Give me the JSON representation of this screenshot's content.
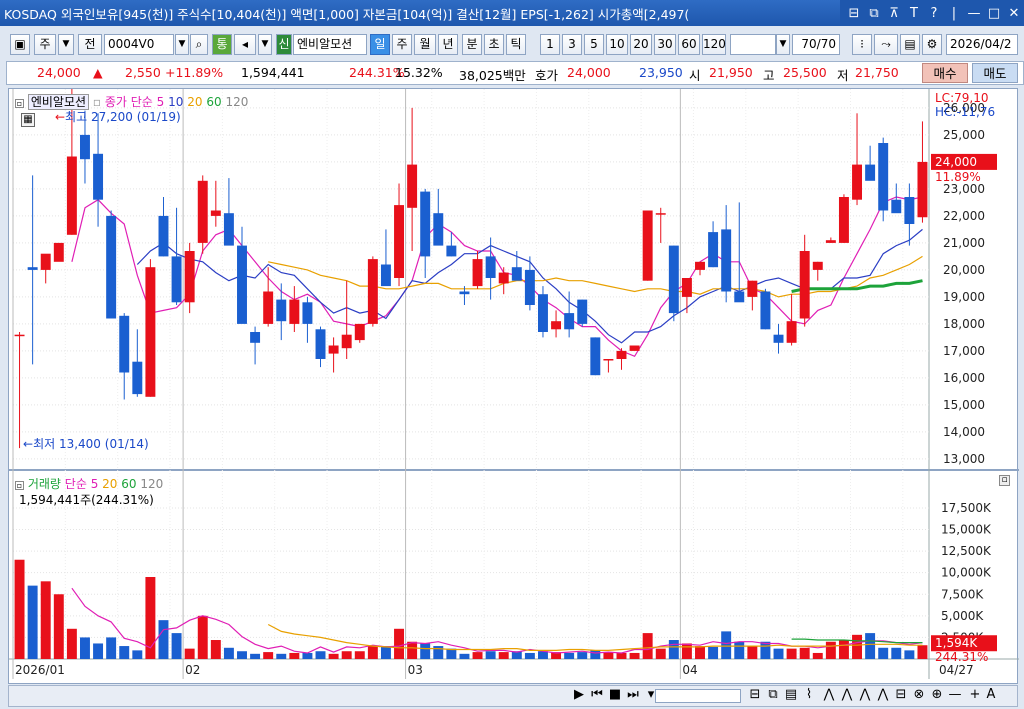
{
  "window": {
    "title": "KOSDAQ 외국인보유[945(천)] 주식수[10,404(천)] 액면[1,000] 자본금[104(억)] 결산[12월] EPS[-1,262] 시가총액[2,497(",
    "controls": [
      "⊟",
      "⧉",
      "⊼",
      "T",
      "?",
      "|",
      "—",
      "□",
      "✕"
    ]
  },
  "toolbar": {
    "code_type": "주",
    "period_label": "전",
    "code": "0004V0",
    "tong": "통",
    "sin": "신",
    "stock_name": "엔비알모션",
    "periods": [
      "일",
      "주",
      "월",
      "년",
      "분",
      "초",
      "틱"
    ],
    "selected_period": "일",
    "intervals": [
      "1",
      "3",
      "5",
      "10",
      "20",
      "30",
      "60",
      "120"
    ],
    "count": "70/70",
    "date": "2026/04/2"
  },
  "quote": {
    "price": "24,000",
    "arrow": "▲",
    "change": "2,550",
    "change_pct": "+11.89%",
    "volume": "1,594,441",
    "vol_ratio": "244.31%",
    "turnover": "15.32%",
    "amount": "38,025백만",
    "hoga_label": "호가",
    "hoga_ask": "24,000",
    "hoga_bid": "23,950",
    "open_label": "시",
    "open": "21,950",
    "high_label": "고",
    "high": "25,500",
    "low_label": "저",
    "low": "21,750",
    "buy_label": "매수",
    "sell_label": "매도"
  },
  "chart_data": {
    "type": "candlestick",
    "price_legend": {
      "name": "엔비알모션",
      "ma_label": "종가 단순",
      "ma_periods": [
        "5",
        "10",
        "20",
        "60",
        "120"
      ]
    },
    "volume_legend": {
      "name": "거래량",
      "ma_label": "단순",
      "ma_periods": [
        "5",
        "20",
        "60",
        "120"
      ],
      "value": "1,594,441주(244.31%)"
    },
    "annotations": {
      "high": "최고 27,200 (01/19)",
      "low": "최저 13,400 (01/14)"
    },
    "lc_hc": {
      "lc": "LC:79,10",
      "hc": "HC:-11,76"
    },
    "y_ticks": [
      "26,000",
      "25,000",
      "24,000",
      "23,000",
      "22,000",
      "21,000",
      "20,000",
      "19,000",
      "18,000",
      "17,000",
      "16,000",
      "15,000",
      "14,000",
      "13,000"
    ],
    "ylim": [
      12700,
      26700
    ],
    "current_price": {
      "value": 24000,
      "label": "24,000",
      "pct": "11.89%"
    },
    "vol_ticks": [
      "17,500K",
      "15,000K",
      "12,500K",
      "10,000K",
      "7,500K",
      "5,000K",
      "2,500K"
    ],
    "vol_ylim": [
      0,
      19000
    ],
    "current_volume": {
      "label": "1,594K",
      "pct": "244.31%"
    },
    "x_labels": [
      {
        "i": 0,
        "label": "2026/01"
      },
      {
        "i": 13,
        "label": "02"
      },
      {
        "i": 30,
        "label": "03"
      },
      {
        "i": 51,
        "label": "04"
      }
    ],
    "x_end_label": "04/27",
    "candles": [
      [
        17600,
        17700,
        13400,
        17600,
        11500
      ],
      [
        20100,
        23500,
        16500,
        20000,
        8500
      ],
      [
        20000,
        20200,
        19500,
        20600,
        9000
      ],
      [
        20300,
        20300,
        20300,
        21000,
        7500
      ],
      [
        21300,
        27200,
        21300,
        24200,
        3500
      ],
      [
        25000,
        25900,
        23200,
        24100,
        2500
      ],
      [
        24300,
        25800,
        21600,
        22600,
        1800
      ],
      [
        22000,
        22200,
        18300,
        18200,
        2500
      ],
      [
        18300,
        18400,
        15200,
        16200,
        1500
      ],
      [
        16600,
        17800,
        15300,
        15400,
        1000
      ],
      [
        15300,
        20400,
        15300,
        20100,
        9500
      ],
      [
        22000,
        22700,
        20500,
        20500,
        4500
      ],
      [
        20500,
        22300,
        18700,
        18800,
        3000
      ],
      [
        18800,
        21000,
        18400,
        20700,
        1200
      ],
      [
        21000,
        23500,
        20600,
        23300,
        5000
      ],
      [
        22000,
        23300,
        21600,
        22200,
        2200
      ],
      [
        22100,
        23400,
        21300,
        20900,
        1300
      ],
      [
        20900,
        21600,
        18200,
        18000,
        900
      ],
      [
        17700,
        17900,
        16500,
        17300,
        600
      ],
      [
        18000,
        20100,
        17900,
        19200,
        800
      ],
      [
        18900,
        19500,
        17400,
        18100,
        600
      ],
      [
        18000,
        19400,
        17700,
        18900,
        700
      ],
      [
        18800,
        19000,
        17300,
        18000,
        700
      ],
      [
        17800,
        17900,
        16400,
        16700,
        900
      ],
      [
        16900,
        17500,
        16200,
        17200,
        600
      ],
      [
        17100,
        19600,
        16700,
        17600,
        900
      ],
      [
        17400,
        18000,
        17300,
        18000,
        900
      ],
      [
        18000,
        20500,
        17900,
        20400,
        1500
      ],
      [
        20200,
        21500,
        19800,
        19400,
        1500
      ],
      [
        19700,
        23200,
        19400,
        22400,
        3500
      ],
      [
        22300,
        26000,
        20700,
        23900,
        2000
      ],
      [
        22900,
        23000,
        19700,
        20500,
        1800
      ],
      [
        22100,
        23000,
        21000,
        20900,
        1500
      ],
      [
        20900,
        21400,
        20500,
        20500,
        1200
      ],
      [
        19200,
        19400,
        18700,
        19100,
        600
      ],
      [
        19400,
        20700,
        19300,
        20400,
        800
      ],
      [
        20500,
        21200,
        18900,
        19700,
        900
      ],
      [
        19500,
        20100,
        19100,
        19900,
        800
      ],
      [
        20100,
        20700,
        19800,
        19600,
        900
      ],
      [
        20000,
        20500,
        18500,
        18700,
        700
      ],
      [
        19100,
        19400,
        17500,
        17700,
        900
      ],
      [
        17800,
        18500,
        17500,
        18100,
        800
      ],
      [
        18400,
        19200,
        17500,
        17800,
        700
      ],
      [
        18900,
        18900,
        17900,
        18000,
        800
      ],
      [
        17500,
        17500,
        16100,
        16100,
        1000
      ],
      [
        16700,
        16700,
        16200,
        16700,
        800
      ],
      [
        16700,
        17100,
        16300,
        17000,
        700
      ],
      [
        17000,
        17200,
        17200,
        17200,
        700
      ],
      [
        19600,
        22100,
        19600,
        22200,
        3000
      ],
      [
        22100,
        22300,
        21000,
        22100,
        1200
      ],
      [
        20900,
        20900,
        18100,
        18400,
        2200
      ],
      [
        19000,
        19600,
        18400,
        19700,
        1800
      ],
      [
        20000,
        20200,
        19800,
        20300,
        1500
      ],
      [
        21400,
        21800,
        20100,
        20100,
        1400
      ],
      [
        21500,
        22400,
        18800,
        19200,
        3200
      ],
      [
        19200,
        22500,
        19000,
        18800,
        2000
      ],
      [
        19000,
        19600,
        18500,
        19600,
        1500
      ],
      [
        19200,
        19300,
        17800,
        17800,
        2000
      ],
      [
        17600,
        18000,
        16900,
        17300,
        1200
      ],
      [
        17300,
        19100,
        17200,
        18100,
        1200
      ],
      [
        18200,
        21300,
        17900,
        20700,
        1300
      ],
      [
        20000,
        20300,
        19600,
        20300,
        700
      ],
      [
        21000,
        21200,
        21000,
        21100,
        2000
      ],
      [
        21000,
        22800,
        21000,
        22700,
        2200
      ],
      [
        22600,
        25800,
        22400,
        23900,
        2800
      ],
      [
        23900,
        24600,
        23500,
        23300,
        3000
      ],
      [
        24700,
        24900,
        21800,
        22200,
        1300
      ],
      [
        22600,
        23200,
        22300,
        22100,
        1300
      ],
      [
        22700,
        23200,
        20900,
        21700,
        1000
      ],
      [
        21950,
        25500,
        21750,
        24000,
        1594
      ]
    ],
    "ma_price": [
      {
        "period": "5",
        "color": "#e01fb5",
        "values": [
          null,
          null,
          null,
          null,
          20300,
          22300,
          22600,
          22100,
          21700,
          19800,
          18400,
          18500,
          18600,
          19100,
          20700,
          21300,
          21500,
          20900,
          20300,
          19700,
          19200,
          18900,
          19100,
          18800,
          18100,
          18000,
          17900,
          18100,
          18300,
          18900,
          19600,
          21200,
          21700,
          21400,
          20900,
          20700,
          20700,
          19900,
          19800,
          19400,
          18900,
          18600,
          18200,
          17900,
          17900,
          17400,
          17000,
          16800,
          17600,
          18600,
          19200,
          19500,
          20300,
          20600,
          20300,
          20300,
          19300,
          19100,
          18600,
          18100,
          18000,
          18500,
          18700,
          19700,
          20600,
          21500,
          22500,
          22700,
          22600,
          22700
        ]
      },
      {
        "period": "10",
        "color": "#2b3ec4",
        "values": [
          null,
          null,
          null,
          null,
          null,
          null,
          null,
          null,
          null,
          20200,
          20700,
          21000,
          20600,
          20400,
          20300,
          19900,
          19600,
          19800,
          19700,
          20200,
          19900,
          19800,
          19300,
          18800,
          18400,
          18600,
          18400,
          18500,
          18200,
          18900,
          19600,
          19500,
          19900,
          20200,
          20600,
          20600,
          20900,
          20700,
          20500,
          20300,
          19700,
          19300,
          18800,
          18500,
          18100,
          17600,
          17300,
          17700,
          17700,
          17900,
          18300,
          18600,
          19000,
          19200,
          19400,
          19200,
          19400,
          19600,
          19700,
          19500,
          19300,
          19300,
          19300,
          19700,
          19700,
          19800,
          20600,
          20900,
          21100,
          21500
        ]
      },
      {
        "period": "20",
        "color": "#e8a000",
        "values": [
          null,
          null,
          null,
          null,
          null,
          null,
          null,
          null,
          null,
          null,
          null,
          null,
          null,
          null,
          null,
          null,
          null,
          null,
          null,
          20300,
          20200,
          20100,
          20000,
          19800,
          19700,
          19600,
          19400,
          19400,
          19300,
          19300,
          19400,
          19500,
          19500,
          19300,
          19300,
          19300,
          19300,
          19500,
          19600,
          19600,
          19600,
          19700,
          19600,
          19600,
          19500,
          19400,
          19300,
          19200,
          19300,
          19300,
          19200,
          19200,
          19100,
          19300,
          19300,
          19300,
          19300,
          19200,
          19000,
          19100,
          19100,
          19200,
          19200,
          19300,
          19400,
          19700,
          19800,
          20000,
          20200,
          20500
        ]
      },
      {
        "period": "60",
        "color": "#1da33a",
        "values": [
          null,
          null,
          null,
          null,
          null,
          null,
          null,
          null,
          null,
          null,
          null,
          null,
          null,
          null,
          null,
          null,
          null,
          null,
          null,
          null,
          null,
          null,
          null,
          null,
          null,
          null,
          null,
          null,
          null,
          null,
          null,
          null,
          null,
          null,
          null,
          null,
          null,
          null,
          null,
          null,
          null,
          null,
          null,
          null,
          null,
          null,
          null,
          null,
          null,
          null,
          null,
          null,
          null,
          null,
          null,
          null,
          null,
          null,
          null,
          19200,
          19300,
          19300,
          19300,
          19300,
          19300,
          19400,
          19400,
          19500,
          19500,
          19600
        ]
      }
    ],
    "ma_volume": [
      {
        "period": "5",
        "color": "#e01fb5",
        "values": [
          null,
          null,
          null,
          null,
          8200,
          6100,
          5000,
          4300,
          2400,
          2000,
          1300,
          3400,
          3600,
          4500,
          5000,
          4600,
          4000,
          2600,
          1700,
          1200,
          1500,
          900,
          700,
          1400,
          800,
          1400,
          1300,
          1600,
          1400,
          1500,
          1900,
          1800,
          2000,
          1600,
          1300,
          900,
          1000,
          1000,
          800,
          1100,
          900,
          700,
          800,
          900,
          700,
          800,
          700,
          1100,
          1100,
          1500,
          1700,
          1700,
          1600,
          2000,
          1800,
          2000,
          2000,
          1800,
          1800,
          1500,
          1500,
          1300,
          1500,
          1600,
          1900,
          2100,
          2100,
          1900,
          1700,
          1900
        ]
      },
      {
        "period": "20",
        "color": "#e8a000",
        "values": [
          null,
          null,
          null,
          null,
          null,
          null,
          null,
          null,
          null,
          null,
          null,
          null,
          null,
          null,
          null,
          null,
          null,
          null,
          null,
          4000,
          3200,
          2900,
          2700,
          2500,
          2200,
          1900,
          1700,
          1500,
          1400,
          1300,
          1300,
          1200,
          1200,
          1100,
          1100,
          1100,
          1100,
          1200,
          1200,
          1000,
          1000,
          1000,
          1100,
          1100,
          1000,
          1000,
          1100,
          1200,
          1300,
          1400,
          1400,
          1400,
          1400,
          1500,
          1500,
          1500,
          1500,
          1500,
          1600,
          1500,
          1500,
          1500,
          1500,
          1600,
          1600,
          1700,
          1700,
          1700,
          1600,
          1600
        ]
      },
      {
        "period": "60",
        "color": "#1da33a",
        "values": [
          null,
          null,
          null,
          null,
          null,
          null,
          null,
          null,
          null,
          null,
          null,
          null,
          null,
          null,
          null,
          null,
          null,
          null,
          null,
          null,
          null,
          null,
          null,
          null,
          null,
          null,
          null,
          null,
          null,
          null,
          null,
          null,
          null,
          null,
          null,
          null,
          null,
          null,
          null,
          null,
          null,
          null,
          null,
          null,
          null,
          null,
          null,
          null,
          null,
          null,
          null,
          null,
          null,
          null,
          null,
          null,
          null,
          null,
          null,
          2300,
          2300,
          2200,
          2200,
          2200,
          2100,
          2100,
          2000,
          1900,
          1900,
          1900
        ]
      }
    ]
  },
  "scroll_icons": [
    "▶",
    "⏮",
    "■",
    "⏭",
    "▾",
    "⊟",
    "⧉",
    "▤",
    "⌇",
    "⋀",
    "⋀",
    "⋀",
    "⋀",
    "⊟",
    "⊗",
    "⊕",
    "—",
    "+",
    "A"
  ]
}
